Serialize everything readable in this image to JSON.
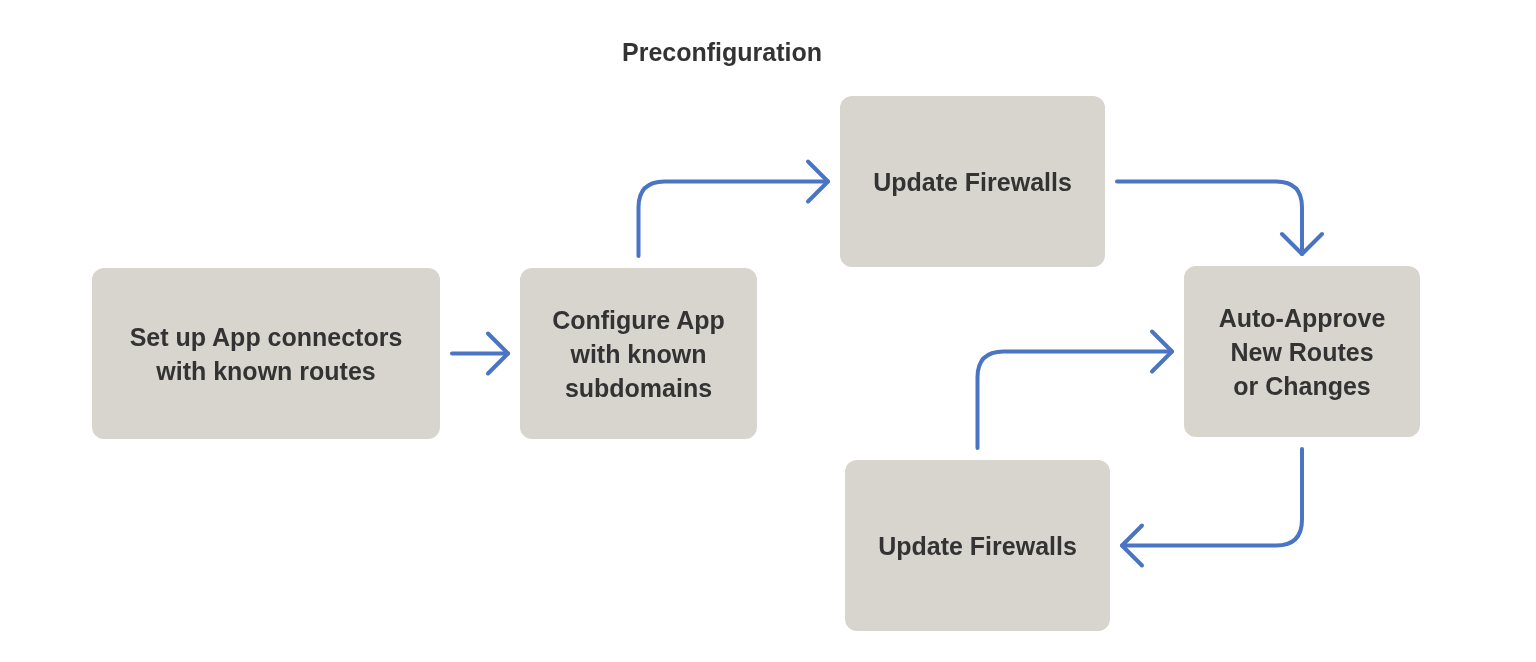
{
  "title": "Preconfiguration",
  "nodes": [
    {
      "label": "Set up App connectors\nwith known routes"
    },
    {
      "label": "Configure App\nwith known\nsubdomains"
    },
    {
      "label": "Update Firewalls"
    },
    {
      "label": "Auto-Approve\nNew Routes\nor Changes"
    },
    {
      "label": "Update Firewalls"
    }
  ]
}
